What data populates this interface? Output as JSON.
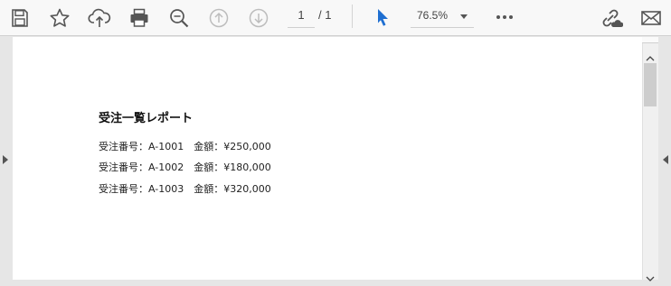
{
  "toolbar": {
    "icons": [
      "save-icon",
      "bookmark-star-icon",
      "cloud-upload-icon",
      "print-icon",
      "zoom-icon",
      "previous-page-icon",
      "next-page-icon",
      "select-cursor-icon",
      "share-link-icon",
      "email-icon"
    ],
    "page_current": "1",
    "page_total": "/ 1",
    "zoom_level": "76.5%",
    "accent_color": "#1f6fd1"
  },
  "document": {
    "title": "受注一覧レポート",
    "lines": [
      "受注番号：A-1001　金額：¥250,000",
      "受注番号：A-1002　金額：¥180,000",
      "受注番号：A-1003　金額：¥320,000"
    ]
  }
}
